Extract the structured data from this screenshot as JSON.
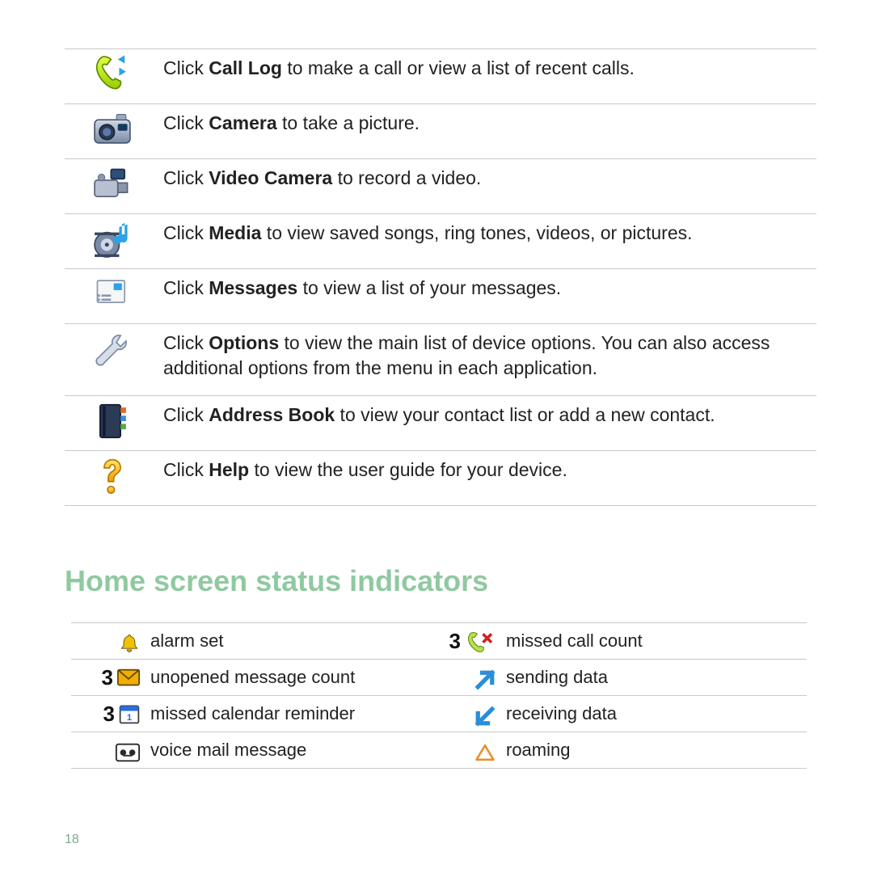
{
  "apps": [
    {
      "pre": "Click ",
      "bold": "Call Log",
      "post": " to make a call or view a list of recent calls."
    },
    {
      "pre": "Click ",
      "bold": "Camera",
      "post": " to take a picture."
    },
    {
      "pre": "Click ",
      "bold": "Video Camera",
      "post": " to record a video."
    },
    {
      "pre": "Click ",
      "bold": "Media",
      "post": " to view saved songs, ring tones, videos, or pictures."
    },
    {
      "pre": "Click ",
      "bold": "Messages",
      "post": " to view a list of your messages."
    },
    {
      "pre": "Click ",
      "bold": "Options",
      "post": " to view the main list of device options. You can also access additional options from the menu in each application."
    },
    {
      "pre": "Click ",
      "bold": "Address Book",
      "post": " to view your contact list or add a new contact."
    },
    {
      "pre": "Click ",
      "bold": "Help",
      "post": " to view the user guide for your device."
    }
  ],
  "section_heading": "Home screen status indicators",
  "indicators_left": [
    {
      "count": "",
      "label": "alarm set"
    },
    {
      "count": "3",
      "label": "unopened message count"
    },
    {
      "count": "3",
      "label": "missed calendar reminder"
    },
    {
      "count": "",
      "label": "voice mail message"
    }
  ],
  "indicators_right": [
    {
      "count": "3",
      "label": "missed call count"
    },
    {
      "count": "",
      "label": "sending data"
    },
    {
      "count": "",
      "label": "receiving data"
    },
    {
      "count": "",
      "label": "roaming"
    }
  ],
  "page_number": "18"
}
